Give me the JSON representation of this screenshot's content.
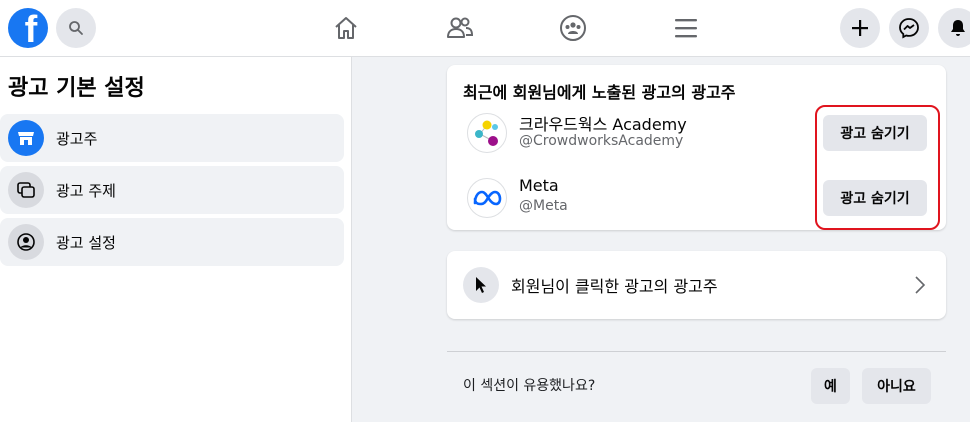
{
  "header": {
    "logo_letter": "f",
    "brand_color": "#1877f2"
  },
  "icons": {
    "search": "search-icon",
    "home": "home-icon",
    "friends": "friends-icon",
    "groups": "groups-icon",
    "menu": "menu-icon",
    "create": "plus-icon",
    "messenger": "messenger-icon",
    "notifications": "bell-icon"
  },
  "sidebar": {
    "title": "광고 기본 설정",
    "items": [
      {
        "label": "광고주",
        "icon": "storefront-icon",
        "active": true
      },
      {
        "label": "광고 주제",
        "icon": "topics-icon",
        "active": false
      },
      {
        "label": "광고 설정",
        "icon": "user-settings-icon",
        "active": false
      }
    ]
  },
  "recent_card": {
    "heading": "최근에 회원님에게 노출된 광고의 광고주",
    "advertisers": [
      {
        "name": "크라우드웍스 Academy",
        "handle": "@CrowdworksAcademy",
        "button": "광고 숨기기"
      },
      {
        "name": "Meta",
        "handle": "@Meta",
        "button": "광고 숨기기"
      }
    ],
    "highlight_color": "#e0141e"
  },
  "clicked_card": {
    "label": "회원님이 클릭한 광고의 광고주"
  },
  "feedback": {
    "question": "이 섹션이 유용했나요?",
    "yes": "예",
    "no": "아니요"
  }
}
